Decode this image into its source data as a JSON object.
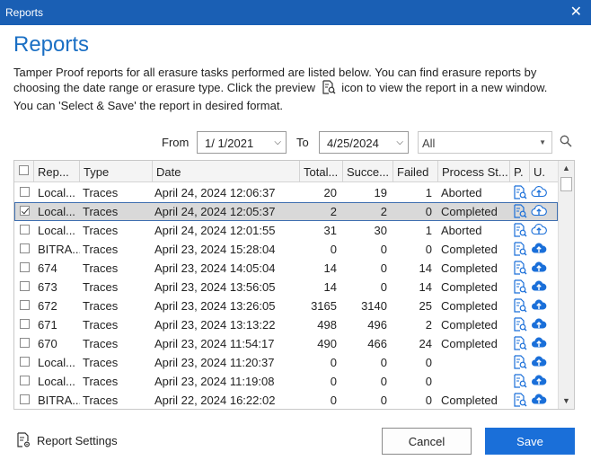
{
  "window": {
    "title": "Reports"
  },
  "heading": "Reports",
  "description": {
    "line1_a": "Tamper Proof reports for all erasure tasks performed are listed below. You can find erasure reports by choosing the date range or erasure type. Click the preview",
    "line1_b": "icon to view the report in a new window.",
    "line2": "You can 'Select & Save' the report in desired format."
  },
  "filters": {
    "from_label": "From",
    "from_value": "1/  1/2021",
    "to_label": "To",
    "to_value": "4/25/2024",
    "type_value": "All"
  },
  "table": {
    "columns": [
      "Rep...",
      "Type",
      "Date",
      "Total...",
      "Succe...",
      "Failed",
      "Process St...",
      "P.",
      "U."
    ],
    "rows": [
      {
        "name": "Local...",
        "type": "Traces",
        "date": "April 24, 2024   12:06:37",
        "total": "20",
        "success": "19",
        "failed": "1",
        "status": "Aborted",
        "checked": false,
        "selected": false
      },
      {
        "name": "Local...",
        "type": "Traces",
        "date": "April 24, 2024   12:05:37",
        "total": "2",
        "success": "2",
        "failed": "0",
        "status": "Completed",
        "checked": true,
        "selected": true
      },
      {
        "name": "Local...",
        "type": "Traces",
        "date": "April 24, 2024   12:01:55",
        "total": "31",
        "success": "30",
        "failed": "1",
        "status": "Aborted",
        "checked": false,
        "selected": false
      },
      {
        "name": "BITRA...",
        "type": "Traces",
        "date": "April 23, 2024   15:28:04",
        "total": "0",
        "success": "0",
        "failed": "0",
        "status": "Completed",
        "checked": false,
        "selected": false
      },
      {
        "name": "674",
        "type": "Traces",
        "date": "April 23, 2024   14:05:04",
        "total": "14",
        "success": "0",
        "failed": "14",
        "status": "Completed",
        "checked": false,
        "selected": false
      },
      {
        "name": "673",
        "type": "Traces",
        "date": "April 23, 2024   13:56:05",
        "total": "14",
        "success": "0",
        "failed": "14",
        "status": "Completed",
        "checked": false,
        "selected": false
      },
      {
        "name": "672",
        "type": "Traces",
        "date": "April 23, 2024   13:26:05",
        "total": "3165",
        "success": "3140",
        "failed": "25",
        "status": "Completed",
        "checked": false,
        "selected": false
      },
      {
        "name": "671",
        "type": "Traces",
        "date": "April 23, 2024   13:13:22",
        "total": "498",
        "success": "496",
        "failed": "2",
        "status": "Completed",
        "checked": false,
        "selected": false
      },
      {
        "name": "670",
        "type": "Traces",
        "date": "April 23, 2024   11:54:17",
        "total": "490",
        "success": "466",
        "failed": "24",
        "status": "Completed",
        "checked": false,
        "selected": false
      },
      {
        "name": "Local...",
        "type": "Traces",
        "date": "April 23, 2024   11:20:37",
        "total": "0",
        "success": "0",
        "failed": "0",
        "status": "",
        "checked": false,
        "selected": false
      },
      {
        "name": "Local...",
        "type": "Traces",
        "date": "April 23, 2024   11:19:08",
        "total": "0",
        "success": "0",
        "failed": "0",
        "status": "",
        "checked": false,
        "selected": false
      },
      {
        "name": "BITRA...",
        "type": "Traces",
        "date": "April 22, 2024   16:22:02",
        "total": "0",
        "success": "0",
        "failed": "0",
        "status": "Completed",
        "checked": false,
        "selected": false
      }
    ]
  },
  "footer": {
    "settings_label": "Report Settings",
    "cancel_label": "Cancel",
    "save_label": "Save"
  },
  "colors": {
    "accent": "#1a6fd9",
    "titlebar": "#1a5fb4",
    "heading": "#1a6fc4"
  }
}
